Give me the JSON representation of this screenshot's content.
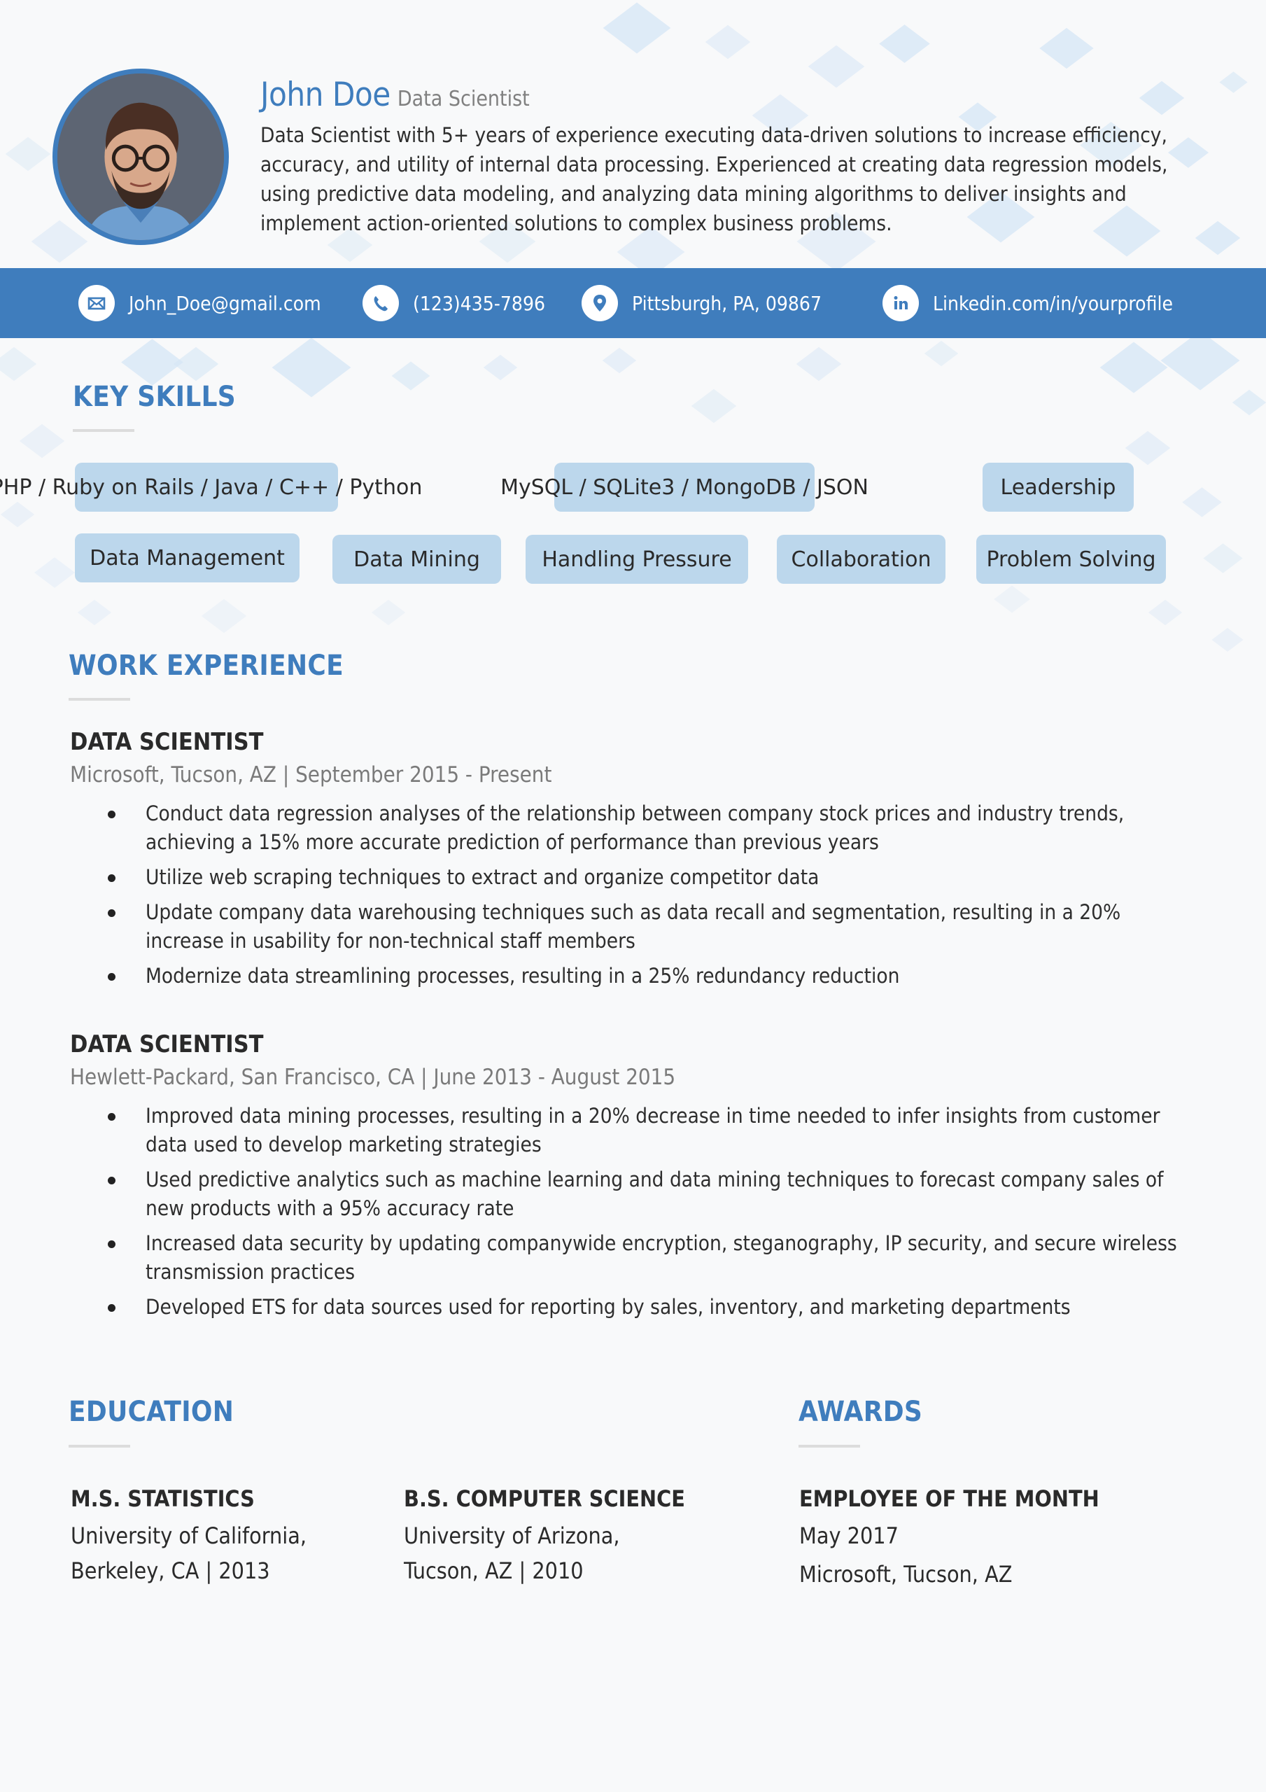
{
  "header": {
    "name": "John Doe",
    "role": "Data Scientist",
    "summary": "Data Scientist with 5+ years of experience executing data-driven solutions to increase efficiency, accuracy, and utility of internal data processing. Experienced at creating data regression models, using predictive data modeling, and analyzing data mining algorithms to deliver insights and implement action-oriented solutions to complex business problems.",
    "photo_alt": "Profile photo of John Doe"
  },
  "contact": {
    "email": {
      "icon": "envelope-icon",
      "text": "John_Doe@gmail.com"
    },
    "phone": {
      "icon": "phone-icon",
      "text": "(123)435-7896"
    },
    "location": {
      "icon": "map-pin-icon",
      "text": "Pittsburgh, PA, 09867"
    },
    "linkedin": {
      "icon": "linkedin-icon",
      "text": "Linkedin.com/in/yourprofile"
    }
  },
  "skills": {
    "title": "KEY SKILLS",
    "items": [
      "PHP / Ruby on Rails / Java / C++ / Python",
      "MySQL / SQLite3 / MongoDB / JSON",
      "Leadership",
      "Data Management",
      "Data Mining",
      "Handling Pressure",
      "Collaboration",
      "Problem Solving"
    ]
  },
  "experience": {
    "title": "WORK EXPERIENCE",
    "jobs": [
      {
        "title": "DATA SCIENTIST",
        "meta": "Microsoft, Tucson, AZ | September 2015 - Present",
        "bullets": [
          "Conduct data regression analyses of the relationship between company stock prices and industry trends, achieving a 15% more accurate prediction of performance than previous years",
          "Utilize web scraping techniques to extract and organize competitor data",
          "Update company data warehousing techniques such as data recall and segmentation, resulting in a 20% increase in usability for non-technical staff members",
          "Modernize data streamlining processes, resulting in a 25% redundancy reduction"
        ]
      },
      {
        "title": "DATA SCIENTIST",
        "meta": "Hewlett-Packard, San Francisco, CA | June 2013 - August 2015",
        "bullets": [
          "Improved data mining processes, resulting in a 20% decrease in time needed to infer insights from customer data used to develop marketing strategies",
          "Used predictive analytics such as machine learning and data mining techniques to forecast company sales of new products with a 95% accuracy rate",
          "Increased data security by updating companywide encryption, steganography, IP security, and secure wireless transmission practices",
          "Developed ETS for data sources used for reporting by sales, inventory, and marketing departments"
        ]
      }
    ]
  },
  "education": {
    "title": "EDUCATION",
    "items": [
      {
        "degree": "M.S. STATISTICS",
        "line1": "University of California,",
        "line2": "Berkeley, CA | 2013"
      },
      {
        "degree": "B.S. COMPUTER SCIENCE",
        "line1": "University of Arizona,",
        "line2": "Tucson, AZ | 2010"
      }
    ]
  },
  "awards": {
    "title": "AWARDS",
    "items": [
      {
        "title": "EMPLOYEE OF THE MONTH",
        "line1": "May 2017",
        "line2": "Microsoft, Tucson, AZ"
      }
    ]
  },
  "colors": {
    "accent": "#3f7dbd",
    "chip": "#bcd7ec",
    "muted_text": "#7a7a7a",
    "body_text": "#2e2e2e"
  }
}
